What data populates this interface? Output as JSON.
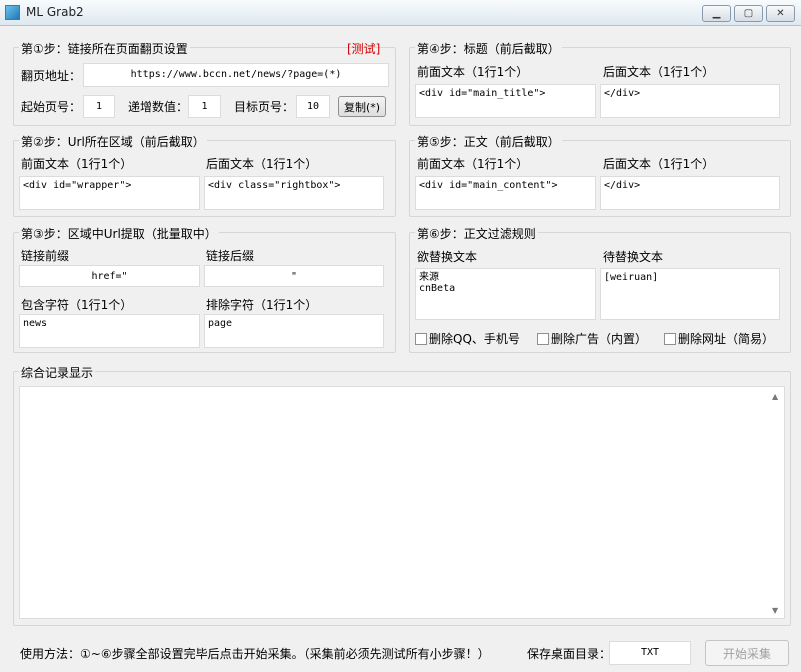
{
  "window": {
    "title": "ML Grab2"
  },
  "step1": {
    "title": "第①步：链接所在页面翻页设置",
    "test_link": "[测试]",
    "url_label": "翻页地址：",
    "url_value": "https://www.bccn.net/news/?page=(*)",
    "start_label": "起始页号：",
    "start_value": "1",
    "step_label": "递增数值：",
    "step_value": "1",
    "target_label": "目标页号：",
    "target_value": "10",
    "copy_button": "复制(*)"
  },
  "step2": {
    "title": "第②步：Url所在区域（前后截取）",
    "before_label": "前面文本（1行1个）",
    "before_value": "<div id=\"wrapper\">",
    "after_label": "后面文本（1行1个）",
    "after_value": "<div class=\"rightbox\">"
  },
  "step3": {
    "title": "第③步：区域中Url提取（批量取中）",
    "prefix_label": "链接前缀",
    "prefix_value": "href=\"",
    "suffix_label": "链接后缀",
    "suffix_value": "\"",
    "include_label": "包含字符（1行1个）",
    "include_value": "news",
    "exclude_label": "排除字符（1行1个）",
    "exclude_value": "page"
  },
  "step4": {
    "title": "第④步：标题（前后截取）",
    "before_label": "前面文本（1行1个）",
    "before_value": "<div id=\"main_title\">",
    "after_label": "后面文本（1行1个）",
    "after_value": "</div>"
  },
  "step5": {
    "title": "第⑤步：正文（前后截取）",
    "before_label": "前面文本（1行1个）",
    "before_value": "<div id=\"main_content\">",
    "after_label": "后面文本（1行1个）",
    "after_value": "</div>"
  },
  "step6": {
    "title": "第⑥步：正文过滤规则",
    "replace_label": "欲替换文本",
    "replace_value": "来源\ncnBeta",
    "with_label": "待替换文本",
    "with_value": "[weiruan]",
    "cb_qq": "删除QQ、手机号",
    "cb_ads": "删除广告（内置）",
    "cb_url": "删除网址（简易）"
  },
  "log": {
    "title": "综合记录显示",
    "content": ""
  },
  "footer": {
    "usage": "使用方法：①~⑥步骤全部设置完毕后点击开始采集。（采集前必须先测试所有小步骤！）",
    "save_label": "保存桌面目录：",
    "save_value": "TXT",
    "start_button": "开始采集"
  },
  "icons": {
    "app": "app-icon",
    "minimize": "minimize-icon",
    "maximize": "maximize-icon",
    "close": "close-icon"
  }
}
